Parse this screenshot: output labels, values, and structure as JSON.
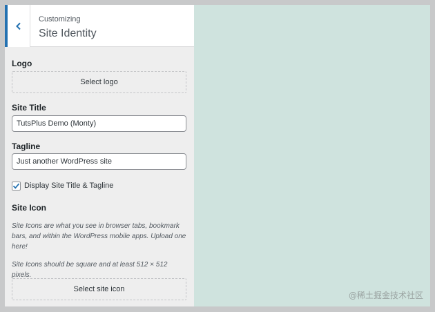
{
  "header": {
    "breadcrumb": "Customizing",
    "title": "Site Identity"
  },
  "logo": {
    "label": "Logo",
    "button": "Select logo"
  },
  "site_title": {
    "label": "Site Title",
    "value": "TutsPlus Demo (Monty)"
  },
  "tagline": {
    "label": "Tagline",
    "value": "Just another WordPress site"
  },
  "display_checkbox": {
    "label": "Display Site Title & Tagline",
    "checked": true
  },
  "site_icon": {
    "label": "Site Icon",
    "description_1": "Site Icons are what you see in browser tabs, bookmark bars, and within the WordPress mobile apps. Upload one here!",
    "description_2": "Site Icons should be square and at least 512 × 512 pixels.",
    "button": "Select site icon"
  },
  "watermark": "@稀土掘金技术社区",
  "colors": {
    "accent": "#2271b1",
    "sidebar_bg": "#eeeeee",
    "preview_bg": "#cfe3de"
  }
}
